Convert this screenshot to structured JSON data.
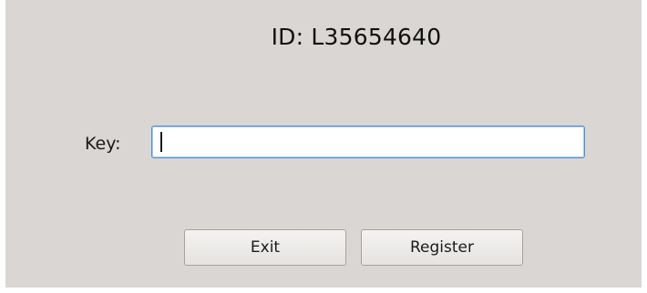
{
  "dialog": {
    "id_text": "ID: L35654640",
    "key_label": "Key:",
    "key_value": "",
    "exit_label": "Exit",
    "register_label": "Register"
  }
}
